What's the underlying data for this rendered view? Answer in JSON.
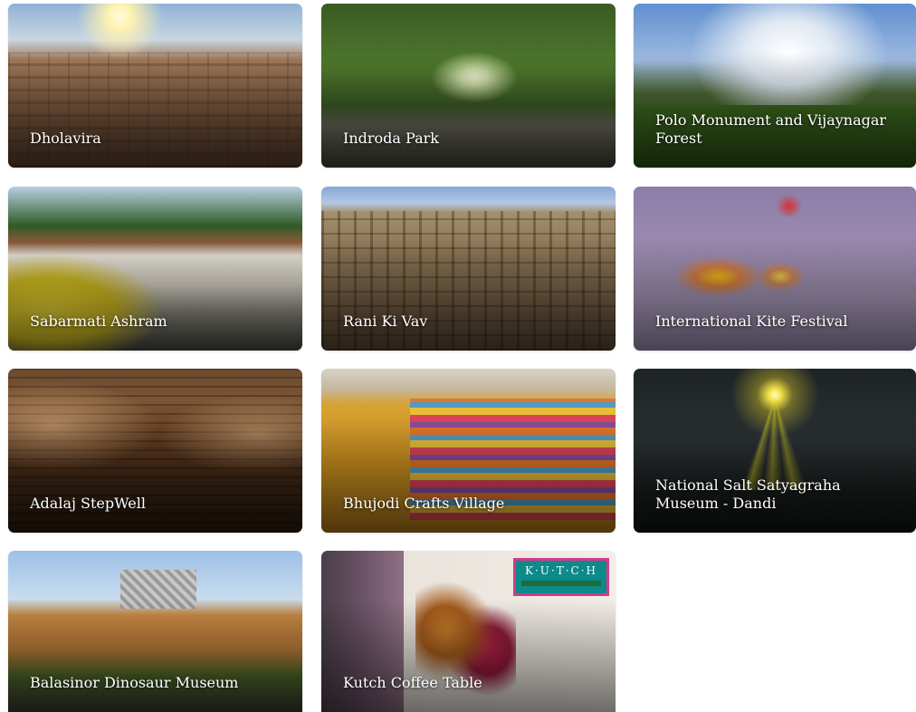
{
  "cards": [
    {
      "title": "Dholavira"
    },
    {
      "title": "Indroda Park"
    },
    {
      "title": "Polo Monument and Vijaynagar Forest"
    },
    {
      "title": "Sabarmati Ashram"
    },
    {
      "title": "Rani Ki Vav"
    },
    {
      "title": "International Kite Festival"
    },
    {
      "title": "Adalaj StepWell"
    },
    {
      "title": "Bhujodi Crafts Village"
    },
    {
      "title": "National Salt Satyagraha Museum - Dandi"
    },
    {
      "title": "Balasinor Dinosaur Museum"
    },
    {
      "title": "Kutch Coffee Table",
      "badge": "K·U·T·C·H"
    }
  ]
}
